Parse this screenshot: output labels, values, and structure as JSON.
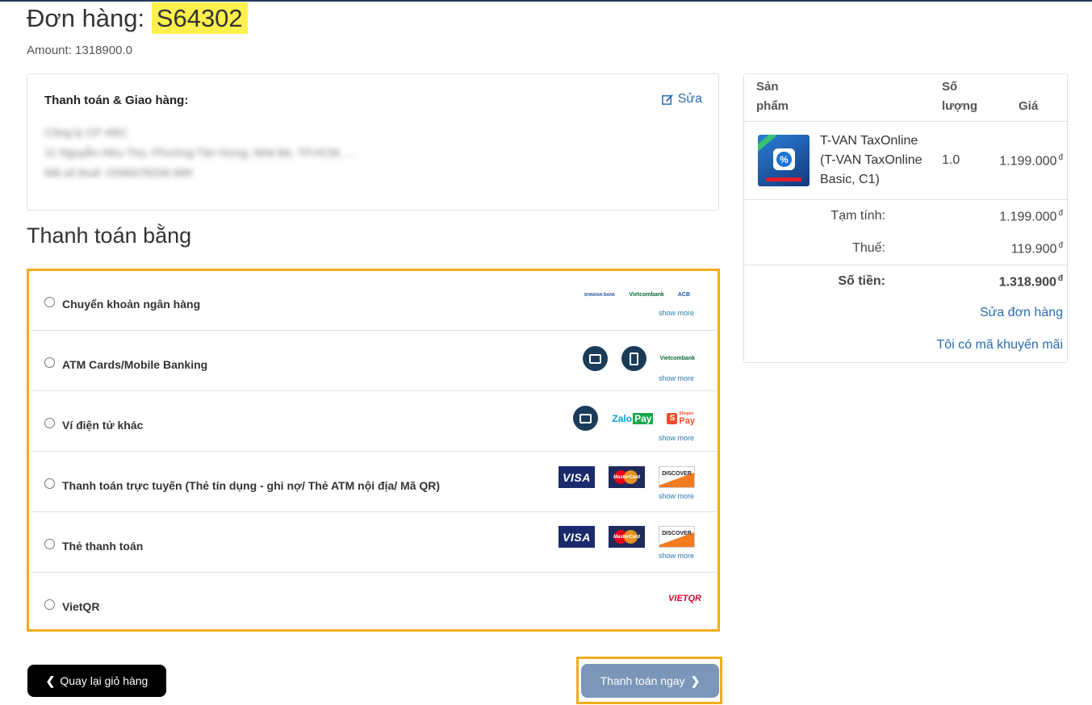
{
  "order": {
    "label": "Đơn hàng:",
    "code": "S64302",
    "amount_text": "Amount: 1318900.0"
  },
  "billing": {
    "title": "Thanh toán & Giao hàng:",
    "edit_label": "Sửa",
    "lines": [
      "Công ty CP ABC",
      "11 Nguyễn Hữu Thọ, Phường Tân Hưng, Nhà Bè, TP.HCM, ...",
      "Mã số thuế: 0306978208-999"
    ]
  },
  "payment": {
    "heading": "Thanh toán bằng",
    "show_more": "show more",
    "methods": [
      {
        "label": "Chuyển khoản ngân hàng",
        "logos": [
          "shinhan-bank-logo",
          "vietcombank-logo",
          "acb-logo"
        ],
        "logo_texts": [
          "SHINHAN BANK",
          "Vietcombank",
          "ACB"
        ]
      },
      {
        "label": "ATM Cards/Mobile Banking",
        "logos": [
          "atm-card-icon",
          "mobile-banking-icon",
          "vietcombank-logo"
        ],
        "logo_texts": [
          "Vietcombank"
        ]
      },
      {
        "label": "Ví điện tử khác",
        "logos": [
          "wallet-icon",
          "zalopay-logo",
          "shopeepay-logo"
        ],
        "logo_texts": [
          "Zalo",
          "Pay",
          "Shopee",
          "Pay"
        ]
      },
      {
        "label": "Thanh toán trực tuyến (Thẻ tín dụng - ghi nợ/ Thẻ ATM nội địa/ Mã QR)",
        "logos": [
          "visa-logo",
          "mastercard-logo",
          "discover-logo"
        ],
        "logo_texts": [
          "VISA",
          "MasterCard",
          "DISCOVER"
        ]
      },
      {
        "label": "Thẻ thanh toán",
        "logos": [
          "visa-logo",
          "mastercard-logo",
          "discover-logo"
        ],
        "logo_texts": [
          "VISA",
          "MasterCard",
          "DISCOVER"
        ]
      },
      {
        "label": "VietQR",
        "logos": [
          "vietqr-logo"
        ],
        "logo_texts": [
          "VIETQR"
        ]
      }
    ]
  },
  "buttons": {
    "back": "Quay lại giỏ hàng",
    "pay": "Thanh toán ngay"
  },
  "summary": {
    "col_product": [
      "Sản",
      "phẩm"
    ],
    "col_qty": [
      "Số",
      "lượng"
    ],
    "col_price": "Giá",
    "item": {
      "name_lines": [
        "T-VAN TaxOnline",
        "(T-VAN TaxOnline",
        "Basic, C1)"
      ],
      "qty": "1.0",
      "price": "1.199.000",
      "image_text": "%"
    },
    "currency": "đ",
    "subtotal_label": "Tạm tính:",
    "subtotal": "1.199.000",
    "tax_label": "Thuế:",
    "tax": "119.900",
    "total_label": "Số tiền:",
    "total": "1.318.900",
    "edit_order": "Sửa đơn hàng",
    "promo": "Tôi có mã khuyến mãi"
  },
  "colors": {
    "highlight": "#fff14d",
    "accent_border": "#f0ad1b",
    "link": "#2b6cb0",
    "pay_button": "#7b96b8",
    "back_button": "#000000"
  }
}
